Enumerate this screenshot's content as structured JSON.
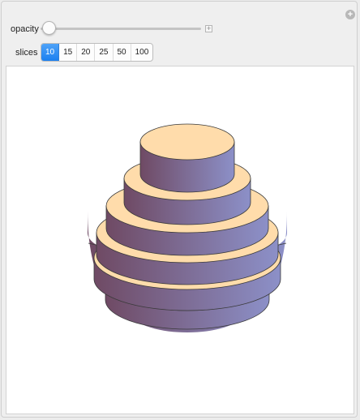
{
  "controls": {
    "opacity_label": "opacity",
    "slices_label": "slices",
    "slices_options": [
      "10",
      "15",
      "20",
      "25",
      "50",
      "100"
    ],
    "slices_selected": "10",
    "opacity_value": 0
  },
  "plot": {
    "face_color": "#ffdcab",
    "side_gradient": [
      "#6f4a64",
      "#8c90c8"
    ],
    "edge_color": "#3a3a3a",
    "slice_count": 10
  },
  "icons": {
    "corner": "plus-circle-icon",
    "slider_increment": "plus-square-icon"
  }
}
